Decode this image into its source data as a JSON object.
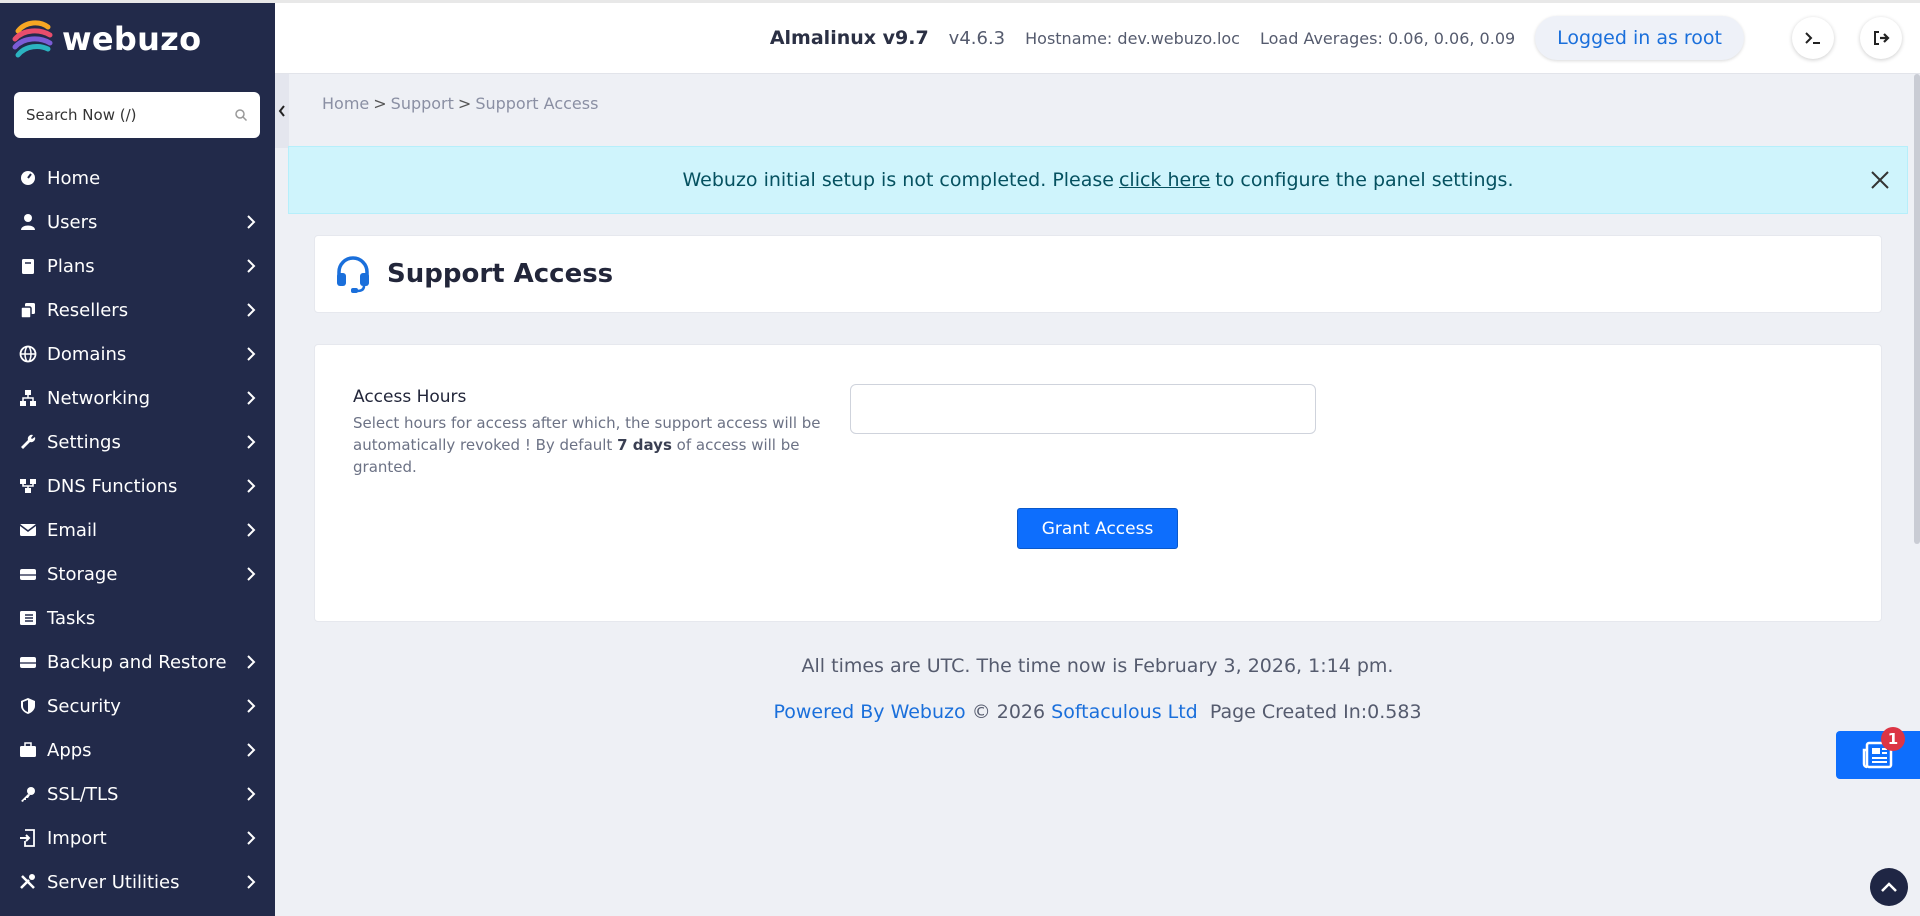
{
  "brand": {
    "name": "webuzo"
  },
  "search": {
    "placeholder": "Search Now (/)"
  },
  "sidebar": {
    "items": [
      {
        "label": "Home",
        "icon": "dashboard-icon",
        "has_children": false
      },
      {
        "label": "Users",
        "icon": "user-icon",
        "has_children": true
      },
      {
        "label": "Plans",
        "icon": "book-icon",
        "has_children": true
      },
      {
        "label": "Resellers",
        "icon": "copy-icon",
        "has_children": true
      },
      {
        "label": "Domains",
        "icon": "globe-icon",
        "has_children": true
      },
      {
        "label": "Networking",
        "icon": "network-icon",
        "has_children": true
      },
      {
        "label": "Settings",
        "icon": "wrench-icon",
        "has_children": true
      },
      {
        "label": "DNS Functions",
        "icon": "sitemap-icon",
        "has_children": true
      },
      {
        "label": "Email",
        "icon": "envelope-icon",
        "has_children": true
      },
      {
        "label": "Storage",
        "icon": "hdd-icon",
        "has_children": true
      },
      {
        "label": "Tasks",
        "icon": "list-icon",
        "has_children": false
      },
      {
        "label": "Backup and Restore",
        "icon": "hdd-icon",
        "has_children": true
      },
      {
        "label": "Security",
        "icon": "shield-icon",
        "has_children": true
      },
      {
        "label": "Apps",
        "icon": "briefcase-icon",
        "has_children": true
      },
      {
        "label": "SSL/TLS",
        "icon": "key-icon",
        "has_children": true
      },
      {
        "label": "Import",
        "icon": "import-icon",
        "has_children": true
      },
      {
        "label": "Server Utilities",
        "icon": "tools-icon",
        "has_children": true
      }
    ]
  },
  "topbar": {
    "os": "Almalinux v9.7",
    "version": "v4.6.3",
    "hostname": "Hostname: dev.webuzo.loc",
    "load": "Load Averages: 0.06, 0.06, 0.09",
    "login": "Logged in as root"
  },
  "breadcrumb": {
    "home": "Home",
    "support": "Support",
    "current": "Support Access"
  },
  "alert": {
    "before": "Webuzo initial setup is not completed. Please",
    "link": "click here",
    "after": "to configure the panel settings."
  },
  "page": {
    "title": "Support Access"
  },
  "form": {
    "label": "Access Hours",
    "desc_before": "Select hours for access after which, the support access will be automatically revoked ! By default",
    "desc_bold": "7 days",
    "desc_after": "of access will be granted.",
    "value": "",
    "button": "Grant Access"
  },
  "footer": {
    "time": "All times are UTC. The time now is February 3, 2026, 1:14 pm.",
    "powered": "Powered By Webuzo",
    "copyright": "© 2026",
    "company": "Softaculous Ltd",
    "created": "Page Created In:0.583"
  },
  "news": {
    "badge": "1"
  },
  "colors": {
    "sidebar": "#222a4a",
    "accent": "#0d6efd",
    "alert_bg": "#cff4fc"
  }
}
